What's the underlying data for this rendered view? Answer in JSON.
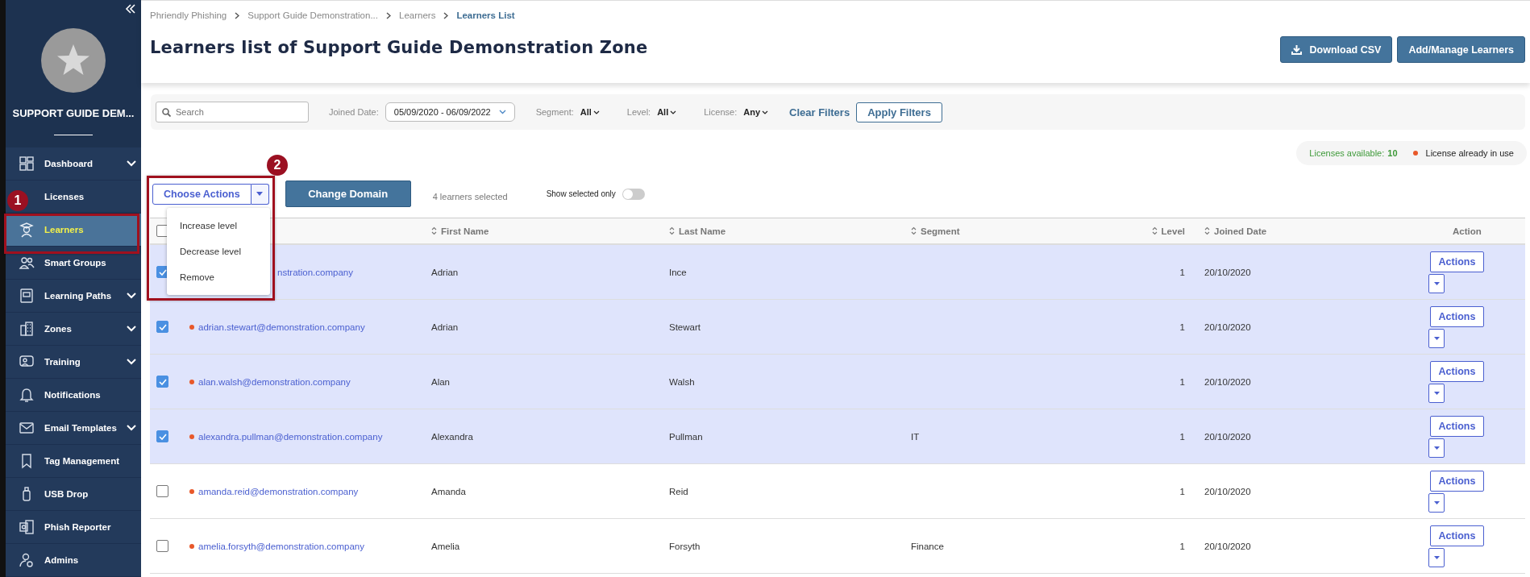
{
  "sidebar": {
    "zone_name": "SUPPORT GUIDE DEM...",
    "items": [
      {
        "label": "Dashboard",
        "expandable": true,
        "selected": false
      },
      {
        "label": "Licenses",
        "expandable": false,
        "selected": false
      },
      {
        "label": "Learners",
        "expandable": false,
        "selected": true
      },
      {
        "label": "Smart Groups",
        "expandable": false,
        "selected": false
      },
      {
        "label": "Learning Paths",
        "expandable": true,
        "selected": false
      },
      {
        "label": "Zones",
        "expandable": true,
        "selected": false
      },
      {
        "label": "Training",
        "expandable": true,
        "selected": false
      },
      {
        "label": "Notifications",
        "expandable": false,
        "selected": false
      },
      {
        "label": "Email Templates",
        "expandable": true,
        "selected": false
      },
      {
        "label": "Tag Management",
        "expandable": false,
        "selected": false
      },
      {
        "label": "USB Drop",
        "expandable": false,
        "selected": false
      },
      {
        "label": "Phish Reporter",
        "expandable": false,
        "selected": false
      },
      {
        "label": "Admins",
        "expandable": false,
        "selected": false
      }
    ]
  },
  "breadcrumb": [
    {
      "label": "Phriendly Phishing",
      "current": false
    },
    {
      "label": "Support Guide Demonstration...",
      "current": false
    },
    {
      "label": "Learners",
      "current": false
    },
    {
      "label": "Learners List",
      "current": true
    }
  ],
  "page_title": "Learners list of Support Guide Demonstration Zone",
  "header_buttons": [
    {
      "label": "Download CSV",
      "kind": "download"
    },
    {
      "label": "Add/Manage Learners",
      "kind": "plain"
    }
  ],
  "filters": {
    "search": {
      "placeholder": "Search"
    },
    "joined_date": {
      "label": "Joined Date:",
      "value": "05/09/2020 - 06/09/2022"
    },
    "selects": [
      {
        "label": "Segment:",
        "value": "All"
      },
      {
        "label": "Level:",
        "value": "All"
      },
      {
        "label": "License:",
        "value": "Any"
      }
    ],
    "clear": "Clear Filters",
    "apply": "Apply Filters"
  },
  "license_info": {
    "label": "Licenses available:",
    "count": "10",
    "legend": "License already in use"
  },
  "toolbar": {
    "choose_actions": "Choose Actions",
    "menu": {
      "expanded": true,
      "items": [
        "Increase level",
        "Decrease level",
        "Remove"
      ]
    },
    "change_domain": "Change Domain",
    "selected_count": "4 learners selected",
    "show_selected": {
      "label": "Show selected only",
      "on": false
    }
  },
  "table": {
    "all_checked": false,
    "columns": [
      {
        "label": "First Name",
        "sortable": true
      },
      {
        "label": "Last Name",
        "sortable": true
      },
      {
        "label": "Segment",
        "sortable": true
      },
      {
        "label": "Level",
        "sortable": true
      },
      {
        "label": "Joined Date",
        "sortable": true
      },
      {
        "label": "Action",
        "sortable": false
      }
    ],
    "rows": [
      {
        "selected": true,
        "covered": true,
        "license_in_use": false,
        "email": "nstration.company",
        "first_name": "Adrian",
        "last_name": "Ince",
        "level": "1",
        "joined": "20/10/2020",
        "action": "Actions"
      },
      {
        "selected": true,
        "covered": false,
        "license_in_use": true,
        "email": "adrian.stewart@demonstration.company",
        "first_name": "Adrian",
        "last_name": "Stewart",
        "level": "1",
        "joined": "20/10/2020",
        "action": "Actions"
      },
      {
        "selected": true,
        "covered": false,
        "license_in_use": true,
        "email": "alan.walsh@demonstration.company",
        "first_name": "Alan",
        "last_name": "Walsh",
        "level": "1",
        "joined": "20/10/2020",
        "action": "Actions"
      },
      {
        "selected": true,
        "covered": false,
        "license_in_use": true,
        "email": "alexandra.pullman@demonstration.company",
        "first_name": "Alexandra",
        "last_name": "Pullman",
        "segment": "IT",
        "level": "1",
        "joined": "20/10/2020",
        "action": "Actions"
      },
      {
        "selected": false,
        "covered": false,
        "license_in_use": true,
        "email": "amanda.reid@demonstration.company",
        "first_name": "Amanda",
        "last_name": "Reid",
        "level": "1",
        "joined": "20/10/2020",
        "action": "Actions"
      },
      {
        "selected": false,
        "covered": false,
        "license_in_use": true,
        "email": "amelia.forsyth@demonstration.company",
        "first_name": "Amelia",
        "last_name": "Forsyth",
        "segment": "Finance",
        "level": "1",
        "joined": "20/10/2020",
        "action": "Actions"
      }
    ]
  },
  "annotations": [
    {
      "number": "1",
      "kind": "nav"
    },
    {
      "number": "2",
      "kind": "toolbar"
    }
  ]
}
